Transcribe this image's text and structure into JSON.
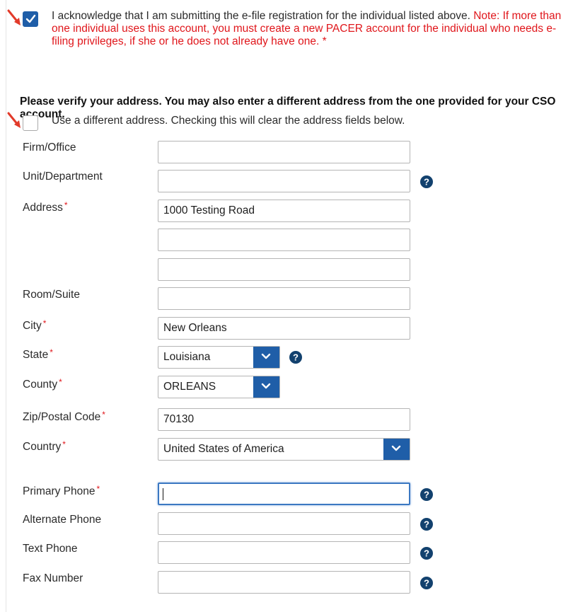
{
  "ack": {
    "checked": true,
    "text": "I acknowledge that I am submitting the e-file registration for the individual listed above.",
    "note": "Note: If more than one individual uses this account, you must create a new PACER account for the individual who needs e-filing privileges, if she or he does not already have one.",
    "required_mark": "*"
  },
  "address_section": {
    "heading": "Please verify your address. You may also enter a different address from the one provided for your CSO account.",
    "different_address_label": "Use a different address. Checking this will clear the address fields below.",
    "different_address_checked": false
  },
  "fields": {
    "firm_office": {
      "label": "Firm/Office",
      "value": ""
    },
    "unit_department": {
      "label": "Unit/Department",
      "value": ""
    },
    "address": {
      "label": "Address",
      "line1": "1000 Testing Road",
      "line2": "",
      "line3": ""
    },
    "room_suite": {
      "label": "Room/Suite",
      "value": ""
    },
    "city": {
      "label": "City",
      "value": "New Orleans"
    },
    "state": {
      "label": "State",
      "value": "Louisiana"
    },
    "county": {
      "label": "County",
      "value": "ORLEANS"
    },
    "zip": {
      "label": "Zip/Postal Code",
      "value": "70130"
    },
    "country": {
      "label": "Country",
      "value": "United States of America"
    },
    "primary_phone": {
      "label": "Primary Phone",
      "value": ""
    },
    "alternate_phone": {
      "label": "Alternate Phone",
      "value": ""
    },
    "text_phone": {
      "label": "Text Phone",
      "value": ""
    },
    "fax_number": {
      "label": "Fax Number",
      "value": ""
    }
  },
  "required_mark": "*",
  "colors": {
    "accent": "#1f5ea8",
    "required": "#e0161b",
    "arrow": "#e23a2a",
    "help_icon": "#12416e"
  }
}
